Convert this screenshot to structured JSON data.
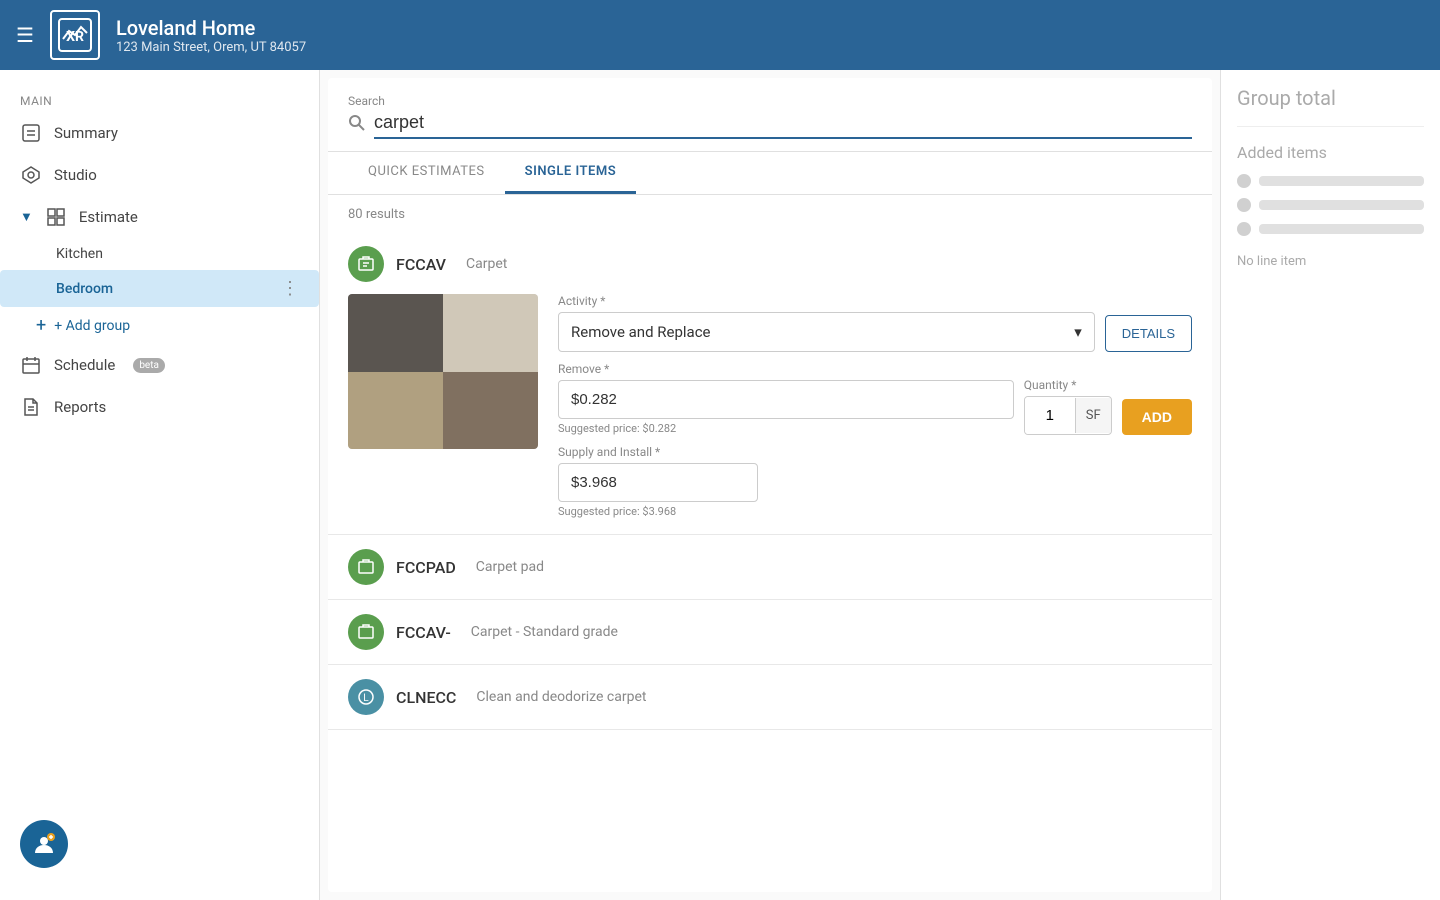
{
  "header": {
    "menu_icon": "☰",
    "logo_text": "XR",
    "title": "Loveland Home",
    "subtitle": "123 Main Street, Orem, UT 84057"
  },
  "sidebar": {
    "section_label": "Main",
    "items": [
      {
        "id": "summary",
        "label": "Summary",
        "icon": "○"
      },
      {
        "id": "studio",
        "label": "Studio",
        "icon": "✦"
      },
      {
        "id": "estimate",
        "label": "Estimate",
        "icon": "▦",
        "expanded": true
      }
    ],
    "sub_items": [
      {
        "id": "kitchen",
        "label": "Kitchen"
      },
      {
        "id": "bedroom",
        "label": "Bedroom",
        "active": true
      }
    ],
    "add_group_label": "+ Add group",
    "schedule_label": "Schedule",
    "schedule_badge": "beta",
    "reports_label": "Reports"
  },
  "search": {
    "label": "Search",
    "value": "carpet",
    "placeholder": "Search carpet"
  },
  "tabs": [
    {
      "id": "quick-estimates",
      "label": "QUICK ESTIMATES",
      "active": false
    },
    {
      "id": "single-items",
      "label": "SINGLE ITEMS",
      "active": true
    }
  ],
  "results_count": "80 results",
  "items": [
    {
      "id": "fccav",
      "badge_icon": "⬡",
      "name": "FCCAV",
      "category": "Carpet",
      "has_image": true,
      "activity": {
        "label": "Activity *",
        "value": "Remove and Replace"
      },
      "details_button": "DETAILS",
      "remove": {
        "label": "Remove *",
        "value": "$0.282",
        "suggested": "Suggested price: $0.282"
      },
      "quantity": {
        "label": "Quantity *",
        "value": "1",
        "unit": "SF"
      },
      "add_button": "ADD",
      "supply_install": {
        "label": "Supply and Install *",
        "value": "$3.968",
        "suggested": "Suggested price: $3.968"
      }
    },
    {
      "id": "fccpad",
      "badge_icon": "⬡",
      "name": "FCCPAD",
      "category": "Carpet pad"
    },
    {
      "id": "fccav-std",
      "badge_icon": "⬡",
      "name": "FCCAV-",
      "category": "Carpet - Standard grade"
    },
    {
      "id": "clnecc",
      "badge_icon": "⬡",
      "name": "CLNECC",
      "category": "Clean and deodorize carpet"
    }
  ],
  "right_panel": {
    "group_total_label": "Group total",
    "added_items_label": "Added items",
    "no_line_item_label": "No line item"
  }
}
